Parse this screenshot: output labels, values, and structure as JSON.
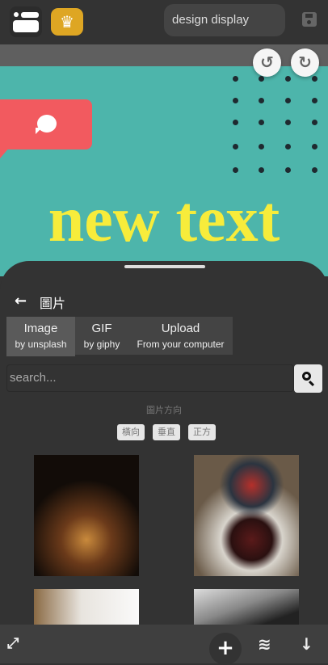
{
  "header": {
    "design_title": "design display",
    "menu_icon": "layout-menu-icon",
    "crown_icon": "crown-icon",
    "save_icon": "floppy-save-icon"
  },
  "canvas": {
    "undo_icon": "undo-icon",
    "redo_icon": "redo-icon",
    "text": "new text",
    "bubble_icon": "chat-bubble-icon",
    "colors": {
      "background": "#4db5ab",
      "text": "#f7ec3b",
      "bubble": "#f25a5f"
    }
  },
  "panel": {
    "title": "圖片",
    "back_icon": "arrow-left-icon",
    "tabs": [
      {
        "label": "Image",
        "sub": "by unsplash",
        "active": true
      },
      {
        "label": "GIF",
        "sub": "by giphy",
        "active": false
      },
      {
        "label": "Upload",
        "sub": "From your computer",
        "active": false
      }
    ],
    "search_placeholder": "search...",
    "orientation_label": "圖片方向",
    "orientations": [
      "橫向",
      "垂直",
      "正方"
    ]
  },
  "bottom": {
    "expand_icon": "expand-icon",
    "add_icon": "plus-icon",
    "layers_icon": "layers-icon",
    "download_icon": "arrow-down-icon"
  }
}
